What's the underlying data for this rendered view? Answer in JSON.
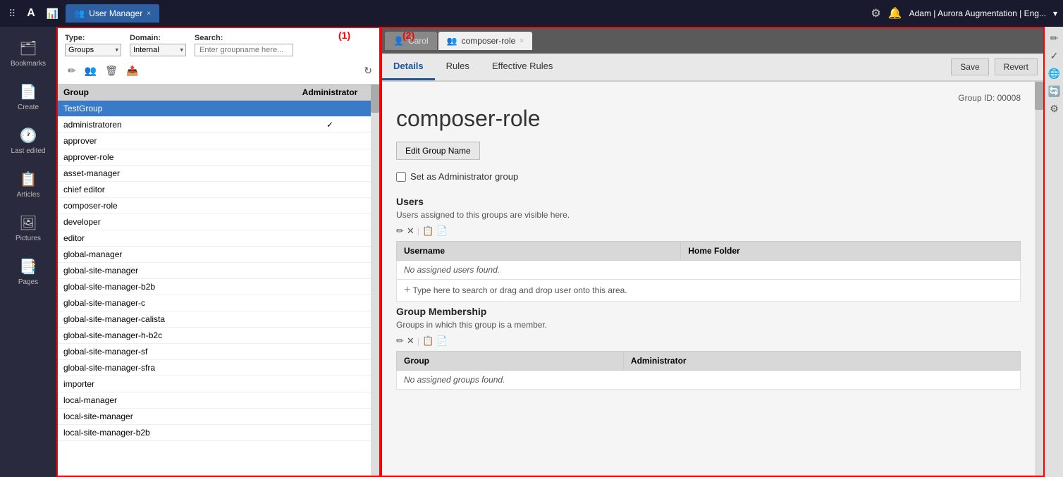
{
  "topbar": {
    "logo": "A",
    "tab_usermanager": "User Manager",
    "tab_close": "×",
    "user_info": "Adam | Aurora Augmentation | Eng...",
    "label_1": "(1)",
    "label_2": "(2)"
  },
  "sidebar_nav": [
    {
      "id": "bookmarks",
      "icon": "🗂",
      "label": "Bookmarks"
    },
    {
      "id": "create",
      "icon": "📄",
      "label": "Create"
    },
    {
      "id": "last-edited",
      "icon": "🕐",
      "label": "Last edited"
    },
    {
      "id": "articles",
      "icon": "📋",
      "label": "Articles"
    },
    {
      "id": "pictures",
      "icon": "🖼",
      "label": "Pictures"
    },
    {
      "id": "pages",
      "icon": "📑",
      "label": "Pages"
    }
  ],
  "groups_panel": {
    "type_label": "Type:",
    "type_value": "Groups",
    "domain_label": "Domain:",
    "domain_value": "Internal",
    "search_label": "Search:",
    "search_placeholder": "Enter groupname here...",
    "toolbar": {
      "edit_icon": "✏",
      "add_users_icon": "👥",
      "delete_icon": "🗑",
      "export_icon": "📤",
      "refresh_icon": "↻"
    },
    "table_headers": [
      "Group",
      "Administrator"
    ],
    "groups": [
      {
        "name": "TestGroup",
        "admin": false,
        "selected": true
      },
      {
        "name": "administratoren",
        "admin": true,
        "selected": false
      },
      {
        "name": "approver",
        "admin": false,
        "selected": false
      },
      {
        "name": "approver-role",
        "admin": false,
        "selected": false
      },
      {
        "name": "asset-manager",
        "admin": false,
        "selected": false
      },
      {
        "name": "chief editor",
        "admin": false,
        "selected": false
      },
      {
        "name": "composer-role",
        "admin": false,
        "selected": false
      },
      {
        "name": "developer",
        "admin": false,
        "selected": false
      },
      {
        "name": "editor",
        "admin": false,
        "selected": false
      },
      {
        "name": "global-manager",
        "admin": false,
        "selected": false
      },
      {
        "name": "global-site-manager",
        "admin": false,
        "selected": false
      },
      {
        "name": "global-site-manager-b2b",
        "admin": false,
        "selected": false
      },
      {
        "name": "global-site-manager-c",
        "admin": false,
        "selected": false
      },
      {
        "name": "global-site-manager-calista",
        "admin": false,
        "selected": false
      },
      {
        "name": "global-site-manager-h-b2c",
        "admin": false,
        "selected": false
      },
      {
        "name": "global-site-manager-sf",
        "admin": false,
        "selected": false
      },
      {
        "name": "global-site-manager-sfra",
        "admin": false,
        "selected": false
      },
      {
        "name": "importer",
        "admin": false,
        "selected": false
      },
      {
        "name": "local-manager",
        "admin": false,
        "selected": false
      },
      {
        "name": "local-site-manager",
        "admin": false,
        "selected": false
      },
      {
        "name": "local-site-manager-b2b",
        "admin": false,
        "selected": false
      }
    ]
  },
  "detail_panel": {
    "tabs": [
      {
        "id": "carol",
        "label": "Carol",
        "icon": "👤",
        "closeable": false
      },
      {
        "id": "composer-role",
        "label": "composer-role",
        "icon": "👥",
        "closeable": true
      }
    ],
    "save_label": "Save",
    "revert_label": "Revert",
    "inner_tabs": [
      {
        "id": "details",
        "label": "Details",
        "active": true
      },
      {
        "id": "rules",
        "label": "Rules",
        "active": false
      },
      {
        "id": "effective-rules",
        "label": "Effective Rules",
        "active": false
      }
    ],
    "group_id": "Group ID: 00008",
    "group_name": "composer-role",
    "edit_button": "Edit Group Name",
    "admin_checkbox_label": "Set as Administrator group",
    "users_section": {
      "title": "Users",
      "description": "Users assigned to this groups are visible here.",
      "columns": [
        "Username",
        "Home Folder"
      ],
      "no_data": "No assigned users found.",
      "add_placeholder": "Type here to search or drag and drop user onto this area."
    },
    "group_membership_section": {
      "title": "Group Membership",
      "description": "Groups in which this group is a member.",
      "columns": [
        "Group",
        "Administrator"
      ],
      "no_data": "No assigned groups found."
    }
  },
  "right_edge": {
    "buttons": [
      "✏",
      "✓",
      "🌐",
      "🔄",
      "⚙"
    ]
  }
}
